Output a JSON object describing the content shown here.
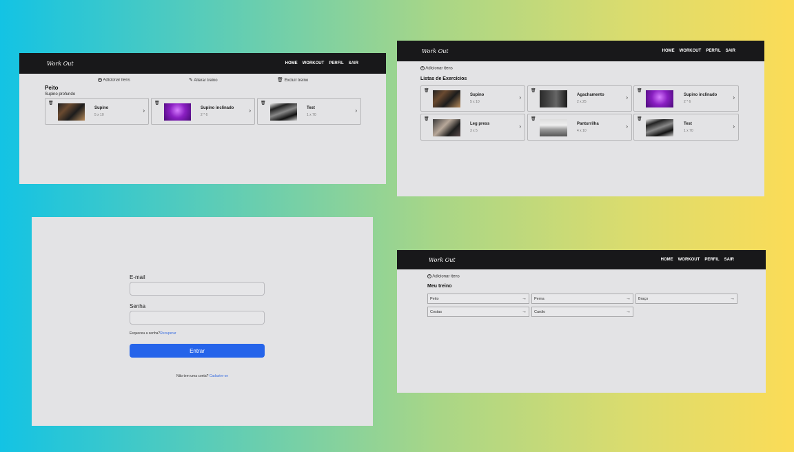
{
  "brand": "Work Out",
  "nav": [
    "HOME",
    "WORKOUT",
    "PERFIL",
    "SAIR"
  ],
  "panel1": {
    "actions": {
      "add": "Adicionar itens",
      "edit": "Alterar treino",
      "delete": "Excluir treino"
    },
    "group_title": "Peito",
    "group_subtitle": "Supino profundo",
    "cards": [
      {
        "name": "Supino",
        "reps": "5 x 10",
        "thumb": "th1"
      },
      {
        "name": "Supino inclinado",
        "reps": "2 * 6",
        "thumb": "th2"
      },
      {
        "name": "Test",
        "reps": "1 x 70",
        "thumb": "th3"
      }
    ]
  },
  "panel2": {
    "add": "Adicionar itens",
    "title": "Listas de Exercícios",
    "cards": [
      {
        "name": "Supino",
        "reps": "5 x 10",
        "thumb": "th1"
      },
      {
        "name": "Agachamento",
        "reps": "2 x 25",
        "thumb": "th5"
      },
      {
        "name": "Supino inclinado",
        "reps": "2 * 6",
        "thumb": "th2"
      },
      {
        "name": "Leg press",
        "reps": "3 x 5",
        "thumb": "th4"
      },
      {
        "name": "Panturrilha",
        "reps": "4 x 10",
        "thumb": "th6"
      },
      {
        "name": "Test",
        "reps": "1 x 70",
        "thumb": "th3"
      }
    ]
  },
  "panel3": {
    "email_label": "E-mail",
    "password_label": "Senha",
    "forgot_text": "Esqueceu a senha?",
    "forgot_link": "Recuperar",
    "submit": "Entrar",
    "signup_text": "Não tem uma conta?",
    "signup_link": "Cadastre-se"
  },
  "panel4": {
    "add": "Adicionar itens",
    "title": "Meu treino",
    "categories": [
      "Peito",
      "Perna",
      "Braço",
      "Costas",
      "Cardio"
    ]
  }
}
